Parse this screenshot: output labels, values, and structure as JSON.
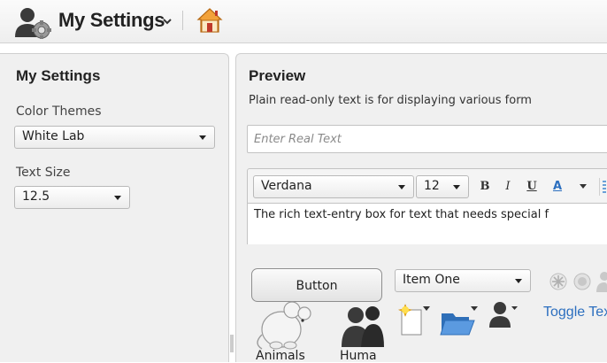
{
  "header": {
    "title": "My Settings",
    "icons": [
      "settings-user-icon",
      "chevron-down-icon",
      "home-icon"
    ]
  },
  "left_panel": {
    "title": "My Settings",
    "color_themes": {
      "label": "Color Themes",
      "value": "White Lab"
    },
    "text_size": {
      "label": "Text Size",
      "value": "12.5"
    }
  },
  "preview": {
    "title": "Preview",
    "description": "Plain read-only text is for displaying various form",
    "text_input": {
      "placeholder": "Enter Real Text",
      "value": ""
    },
    "rich_text": {
      "font": "Verdana",
      "size": "12",
      "bold": "B",
      "italic": "I",
      "underline": "U",
      "font_color": "A",
      "content": "The rich text-entry box for text that needs special f"
    },
    "button_label": "Button",
    "item_dropdown": {
      "value": "Item One"
    },
    "toggle_text": "Toggle Tex",
    "tiles": [
      "Animals",
      "Huma"
    ]
  },
  "colors": {
    "accent_link": "#2c6fbf",
    "panel_bg": "#f0f0f0",
    "underline_a": "#2c6fbf"
  }
}
